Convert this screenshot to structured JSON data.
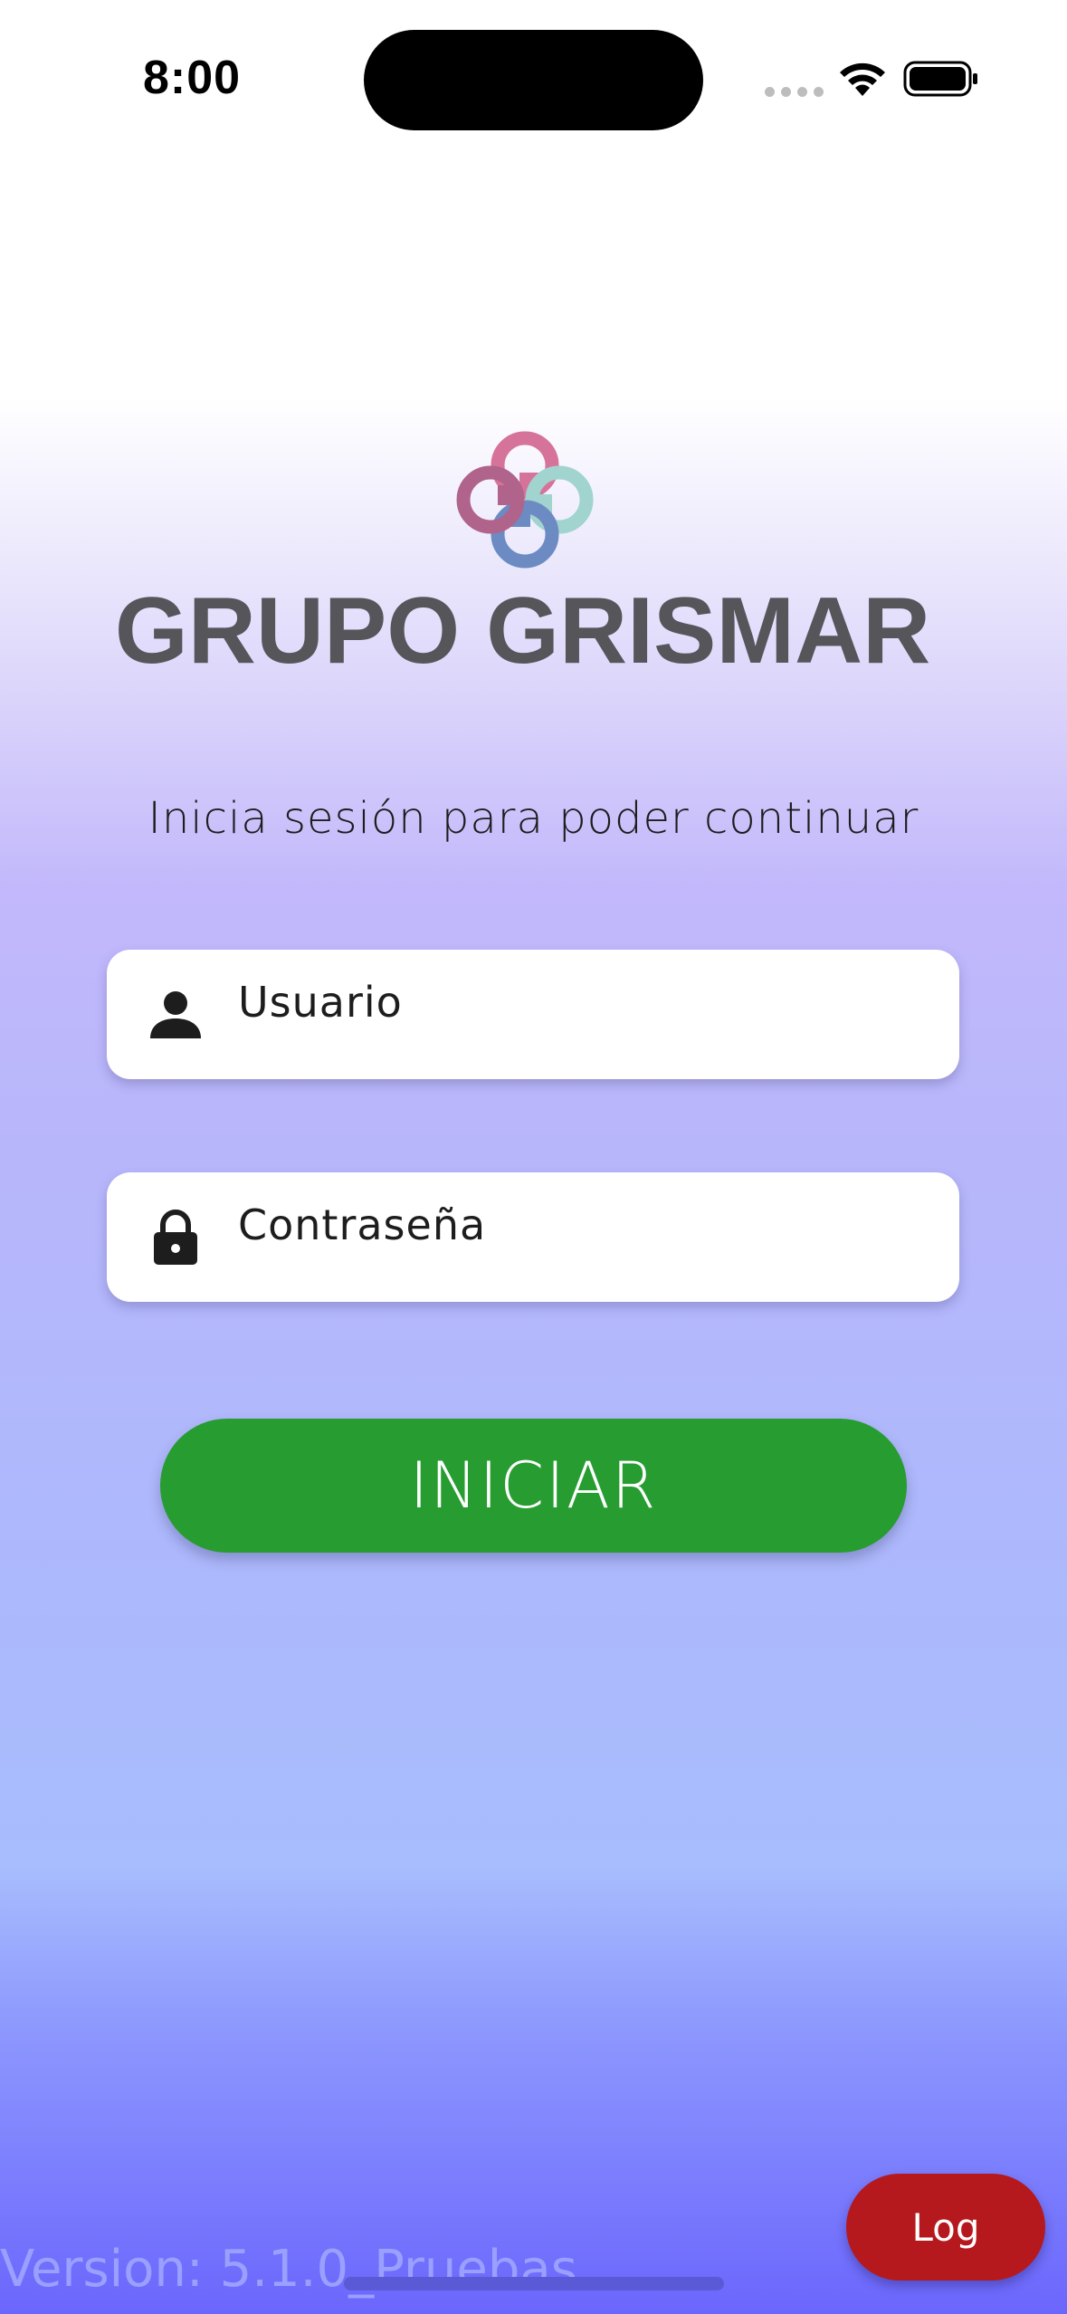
{
  "status_bar": {
    "time": "8:00"
  },
  "brand": {
    "name": "GRUPO GRISMAR",
    "logo_colors": [
      "#d6739a",
      "#a1d3cf",
      "#6c8bc3",
      "#b0638b"
    ]
  },
  "login": {
    "subtitle": "Inicia sesión para poder continuar",
    "username_placeholder": "Usuario",
    "username_icon": "person-icon",
    "password_placeholder": "Contraseña",
    "password_icon": "lock-icon",
    "submit_label": "INICIAR"
  },
  "footer": {
    "version": "Version: 5.1.0_Pruebas",
    "log_label": "Log"
  },
  "colors": {
    "primary_button": "#279c31",
    "log_button": "#b5191e",
    "gradient_top": "#ffffff",
    "gradient_bottom": "#6b66fd"
  }
}
